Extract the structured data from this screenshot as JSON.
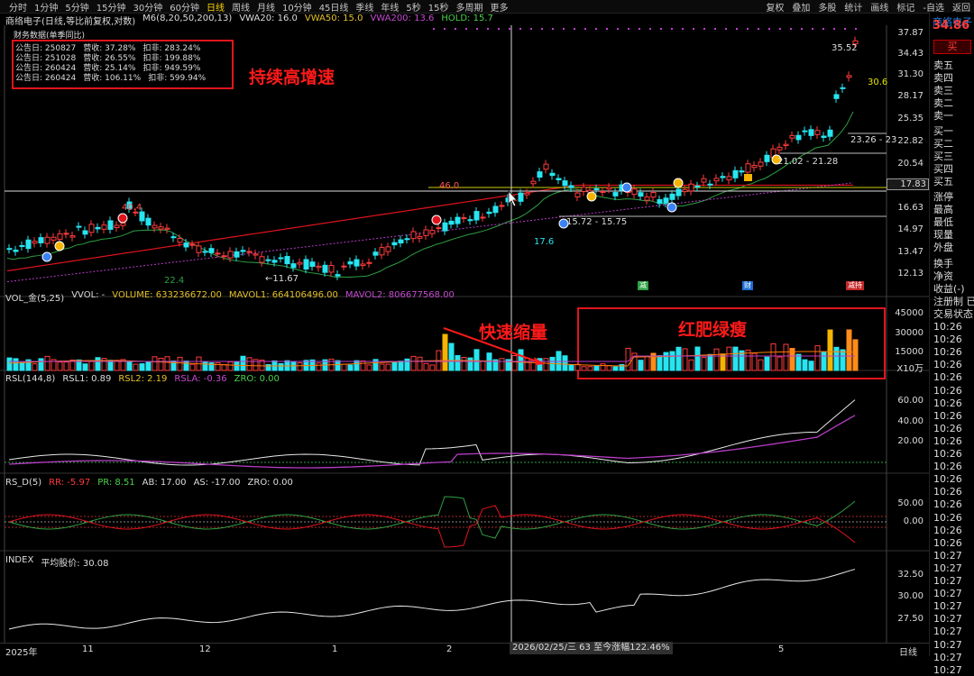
{
  "topbar": {
    "timeframes": [
      "分时",
      "1分钟",
      "5分钟",
      "15分钟",
      "30分钟",
      "60分钟",
      "日线",
      "周线",
      "月线",
      "10分钟",
      "45日线",
      "季线",
      "年线",
      "5秒",
      "15秒",
      "多周期",
      "更多"
    ],
    "active_timeframe": "日线",
    "right_tools": [
      "复权",
      "叠加",
      "多股",
      "统计",
      "画线",
      "标记",
      "-自选",
      "返回"
    ]
  },
  "price_header": {
    "title": "商络电子(日线,等比前复权,对数)",
    "m6": "M6(8,20,50,200,13)",
    "vwa20": "VWA20: 16.0",
    "vwa50": "VWA50: 15.0",
    "vwa200": "VWA200: 13.6",
    "hold": "HOLD: 15.7"
  },
  "financial": {
    "title": "财务数据(单季同比)",
    "rows": [
      {
        "date": "公告日: 250827",
        "rev": "营收: 37.28%",
        "np": "扣非: 283.24%"
      },
      {
        "date": "公告日: 251028",
        "rev": "营收: 26.55%",
        "np": "扣非: 199.88%"
      },
      {
        "date": "公告日: 260424",
        "rev": "营收: 25.14%",
        "np": "扣非: 949.59%"
      },
      {
        "date": "公告日: 260424",
        "rev": "营收: 106.11%",
        "np": "扣非: 599.94%"
      }
    ]
  },
  "annotations": {
    "growth": "持续高增速",
    "shrink": "快速缩量",
    "redgreen": "红肥绿瘦"
  },
  "price_axis": [
    "37.87",
    "34.43",
    "31.30",
    "28.17",
    "25.35",
    "22.82",
    "20.54",
    "18.49",
    "16.63",
    "14.97",
    "13.47",
    "12.13"
  ],
  "price_tags": {
    "high": "35.52",
    "ma": "30.6",
    "peak_left": "40.4",
    "peak_mid": "46.0",
    "low_left": "11.67",
    "low_mid": "17.6",
    "range1": "15.72 - 15.75",
    "range2": "21.02 - 21.28",
    "range3": "23.26 - 23",
    "left_cut": "22.4",
    "current": "17.83"
  },
  "markers": {
    "w": "减",
    "c": "财",
    "h": "减持"
  },
  "vol_header": {
    "name": "VOL_金(5,25)",
    "vvol": "VVOL: -",
    "volume": "VOLUME: 633236672.00",
    "mavol1": "MAVOL1: 664106496.00",
    "mavol2": "MAVOL2: 806677568.00"
  },
  "vol_axis": [
    "45000",
    "30000",
    "15000"
  ],
  "vol_unit": "X10万",
  "rsl_header": {
    "name": "RSL(144,8)",
    "rsl1": "RSL1: 0.89",
    "rsl2": "RSL2: 2.19",
    "rsla": "RSLA: -0.36",
    "zro": "ZRO: 0.00"
  },
  "rsl_axis": [
    "60.00",
    "40.00",
    "20.00"
  ],
  "rsd_header": {
    "name": "RS_D(5)",
    "rr": "RR: -5.97",
    "pr": "PR: 8.51",
    "ab": "AB: 17.00",
    "as": "AS: -17.00",
    "zro": "ZRO: 0.00"
  },
  "rsd_axis": [
    "50.00",
    "0.00"
  ],
  "idx_header": {
    "name": "INDEX",
    "avg": "平均股价: 30.08"
  },
  "idx_axis": [
    "32.50",
    "30.00",
    "27.50"
  ],
  "bottom_axis": [
    "2025年",
    "11",
    "12",
    "1",
    "2",
    "4",
    "5"
  ],
  "date_tip": "2026/02/25/三 63 至今涨幅122.46%",
  "right_bottom": "日线",
  "right_panel": {
    "stock": "商络电子",
    "price": "34.86",
    "price_extra": "3",
    "buy": "买",
    "quote_labels": [
      "卖五",
      "卖四",
      "卖三",
      "卖二",
      "卖一",
      "买一",
      "买二",
      "买三",
      "买四",
      "买五",
      "涨停",
      "最高",
      "最低",
      "现量",
      "外盘",
      "换手",
      "净资",
      "收益(-)",
      "注册制",
      "交易状态:"
    ],
    "quote_suffix": {
      "注册制": "已"
    },
    "times": [
      "10:26",
      "10:26",
      "10:26",
      "10:26",
      "10:26",
      "10:26",
      "10:26",
      "10:26",
      "10:26",
      "10:26",
      "10:26",
      "10:26",
      "10:26",
      "10:26",
      "10:26",
      "10:26",
      "10:26",
      "10:26",
      "10:27",
      "10:27",
      "10:27",
      "10:27",
      "10:27",
      "10:27",
      "10:27",
      "10:27",
      "10:27",
      "10:27"
    ]
  },
  "colors": {
    "up": "#ff3b3b",
    "down": "#27e5f0",
    "ma_green": "#2ea043",
    "ma_red": "#e0141c",
    "ma_purple": "#b93cc7",
    "orange": "#ff8c1a",
    "gold": "#f5b400"
  }
}
